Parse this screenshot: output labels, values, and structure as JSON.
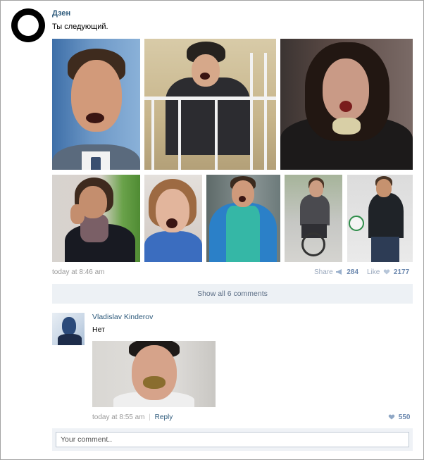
{
  "post": {
    "author": "Дзен",
    "text": "Ты следующий.",
    "time": "today at 8:46 am",
    "share_label": "Share",
    "share_count": "284",
    "like_label": "Like",
    "like_count": "2177"
  },
  "comments": {
    "show_all_label": "Show all 6 comments",
    "items": [
      {
        "author": "Vladislav Kinderov",
        "text": "Нет",
        "time": "today at 8:55 am",
        "separator": "|",
        "reply_label": "Reply",
        "like_count": "550"
      }
    ],
    "placeholder": "Your comment.."
  },
  "colors": {
    "link": "#2b587a",
    "comment_bar": "#edf1f5",
    "meta": "#999999",
    "like_icon": "#8fa7c5"
  },
  "icons": {
    "share": "megaphone-icon",
    "like": "heart-icon",
    "comment_like": "heart-icon"
  }
}
